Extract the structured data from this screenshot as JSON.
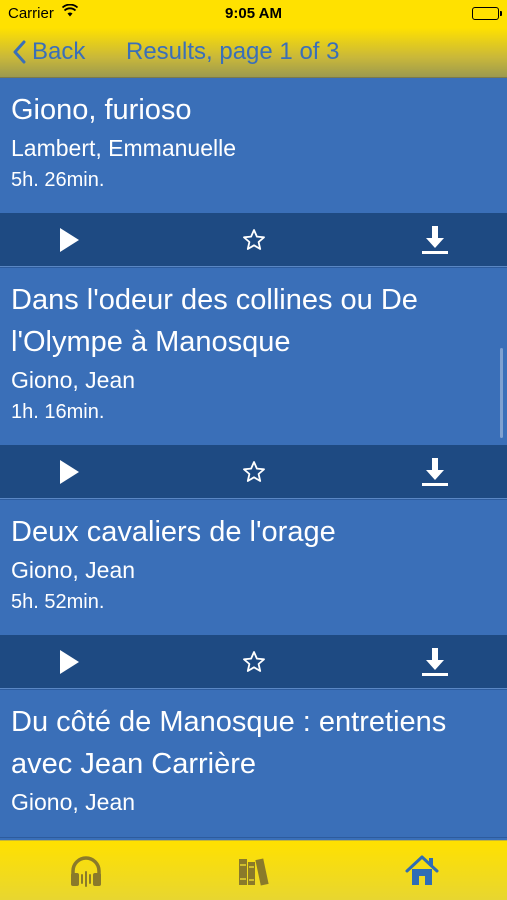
{
  "status_bar": {
    "carrier": "Carrier",
    "time": "9:05 AM"
  },
  "nav": {
    "back_label": "Back",
    "title": "Results, page 1 of 3"
  },
  "results": [
    {
      "title": "Giono, furioso",
      "author": "Lambert, Emmanuelle",
      "duration": "5h. 26min."
    },
    {
      "title": "Dans l'odeur des collines ou De l'Olympe à Manosque",
      "author": "Giono, Jean",
      "duration": "1h. 16min."
    },
    {
      "title": "Deux cavaliers de l'orage",
      "author": "Giono, Jean",
      "duration": "5h. 52min."
    },
    {
      "title": "Du côté de Manosque : entretiens avec Jean Carrière",
      "author": "Giono, Jean",
      "duration": ""
    }
  ],
  "icons": {
    "play": "play-icon",
    "favorite": "star-outline-icon",
    "download": "download-icon",
    "tab_audio": "headphones-icon",
    "tab_library": "books-icon",
    "tab_home": "home-icon"
  },
  "colors": {
    "brand_yellow": "#ffe100",
    "list_background": "#3a6fb8",
    "action_bar": "#1e4a82",
    "nav_text": "#3a6fb8"
  }
}
